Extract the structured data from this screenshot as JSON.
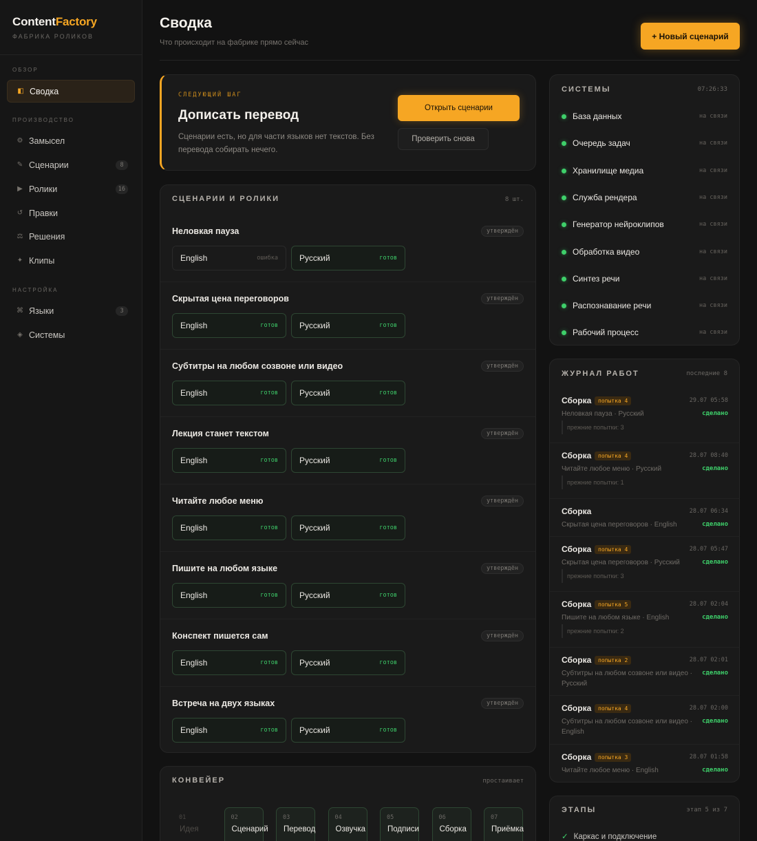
{
  "brand": {
    "name_part1": "Content",
    "name_part2": "Factory",
    "subtitle": "ФАБРИКА РОЛИКОВ"
  },
  "sidebar": {
    "sections": [
      {
        "label": "ОБЗОР"
      },
      {
        "label": "ПРОИЗВОДСТВО"
      },
      {
        "label": "НАСТРОЙКА"
      }
    ],
    "items": [
      {
        "label": "Сводка",
        "icon": "dashboard-icon",
        "glyph": "◧",
        "active": true
      },
      {
        "label": "Замысел",
        "icon": "idea-icon",
        "glyph": "⚙"
      },
      {
        "label": "Сценарии",
        "icon": "pen-icon",
        "glyph": "✎",
        "badge": "8"
      },
      {
        "label": "Ролики",
        "icon": "play-icon",
        "glyph": "▶",
        "badge": "16"
      },
      {
        "label": "Правки",
        "icon": "revisions-icon",
        "glyph": "↺"
      },
      {
        "label": "Решения",
        "icon": "decisions-icon",
        "glyph": "⚖"
      },
      {
        "label": "Клипы",
        "icon": "sparkle-icon",
        "glyph": "✦"
      },
      {
        "label": "Языки",
        "icon": "languages-icon",
        "glyph": "⌘",
        "badge": "3"
      },
      {
        "label": "Системы",
        "icon": "systems-icon",
        "glyph": "◈"
      }
    ]
  },
  "header": {
    "title": "Сводка",
    "subtitle": "Что происходит на фабрике прямо сейчас",
    "new_button": "+ Новый сценарий"
  },
  "next_step": {
    "label": "СЛЕДУЮЩИЙ ШАГ",
    "title": "Дописать перевод",
    "description": "Сценарии есть, но для части языков нет текстов. Без перевода собирать нечего.",
    "primary_button": "Открыть сценарии",
    "secondary_button": "Проверить снова"
  },
  "scripts": {
    "title": "СЦЕНАРИИ И РОЛИКИ",
    "count": "8 шт.",
    "items": [
      {
        "name": "Неловкая пауза",
        "status": "утверждён",
        "langs": [
          {
            "name": "English",
            "status": "ошибка",
            "error": true
          },
          {
            "name": "Русский",
            "status": "готов"
          }
        ]
      },
      {
        "name": "Скрытая цена переговоров",
        "status": "утверждён",
        "langs": [
          {
            "name": "English",
            "status": "готов"
          },
          {
            "name": "Русский",
            "status": "готов"
          }
        ]
      },
      {
        "name": "Субтитры на любом созвоне или видео",
        "status": "утверждён",
        "langs": [
          {
            "name": "English",
            "status": "готов"
          },
          {
            "name": "Русский",
            "status": "готов"
          }
        ]
      },
      {
        "name": "Лекция станет текстом",
        "status": "утверждён",
        "langs": [
          {
            "name": "English",
            "status": "готов"
          },
          {
            "name": "Русский",
            "status": "готов"
          }
        ]
      },
      {
        "name": "Читайте любое меню",
        "status": "утверждён",
        "langs": [
          {
            "name": "English",
            "status": "готов"
          },
          {
            "name": "Русский",
            "status": "готов"
          }
        ]
      },
      {
        "name": "Пишите на любом языке",
        "status": "утверждён",
        "langs": [
          {
            "name": "English",
            "status": "готов"
          },
          {
            "name": "Русский",
            "status": "готов"
          }
        ]
      },
      {
        "name": "Конспект пишется сам",
        "status": "утверждён",
        "langs": [
          {
            "name": "English",
            "status": "готов"
          },
          {
            "name": "Русский",
            "status": "готов"
          }
        ]
      },
      {
        "name": "Встреча на двух языках",
        "status": "утверждён",
        "langs": [
          {
            "name": "English",
            "status": "готов"
          },
          {
            "name": "Русский",
            "status": "готов"
          }
        ]
      }
    ]
  },
  "pipeline": {
    "title": "КОНВЕЙЕР",
    "status": "простаивает",
    "steps": [
      {
        "num": "01",
        "name": "Идея",
        "idle": true
      },
      {
        "num": "02",
        "name": "Сценарий"
      },
      {
        "num": "03",
        "name": "Перевод"
      },
      {
        "num": "04",
        "name": "Озвучка"
      },
      {
        "num": "05",
        "name": "Подписи"
      },
      {
        "num": "06",
        "name": "Сборка"
      },
      {
        "num": "07",
        "name": "Приёмка"
      }
    ]
  },
  "systems": {
    "title": "СИСТЕМЫ",
    "time": "07:26:33",
    "items": [
      {
        "name": "База данных",
        "status": "на связи"
      },
      {
        "name": "Очередь задач",
        "status": "на связи"
      },
      {
        "name": "Хранилище медиа",
        "status": "на связи"
      },
      {
        "name": "Служба рендера",
        "status": "на связи"
      },
      {
        "name": "Генератор нейроклипов",
        "status": "на связи"
      },
      {
        "name": "Обработка видео",
        "status": "на связи"
      },
      {
        "name": "Синтез речи",
        "status": "на связи"
      },
      {
        "name": "Распознавание речи",
        "status": "на связи"
      },
      {
        "name": "Рабочий процесс",
        "status": "на связи"
      }
    ],
    "status_color": "#3ecf6a"
  },
  "journal": {
    "title": "ЖУРНАЛ РАБОТ",
    "meta": "последние 8",
    "items": [
      {
        "name": "Сборка",
        "attempt": "попытка 4",
        "time": "29.07 05:58",
        "desc": "Неловкая пауза · Русский",
        "result": "сделано",
        "prev": "прежние попытки: 3"
      },
      {
        "name": "Сборка",
        "attempt": "попытка 4",
        "time": "28.07 08:40",
        "desc": "Читайте любое меню · Русский",
        "result": "сделано",
        "prev": "прежние попытки: 1"
      },
      {
        "name": "Сборка",
        "attempt": "",
        "time": "28.07 06:34",
        "desc": "Скрытая цена переговоров · English",
        "result": "сделано",
        "prev": ""
      },
      {
        "name": "Сборка",
        "attempt": "попытка 4",
        "time": "28.07 05:47",
        "desc": "Скрытая цена переговоров · Русский",
        "result": "сделано",
        "prev": "прежние попытки: 3"
      },
      {
        "name": "Сборка",
        "attempt": "попытка 5",
        "time": "28.07 02:04",
        "desc": "Пишите на любом языке · English",
        "result": "сделано",
        "prev": "прежние попытки: 2"
      },
      {
        "name": "Сборка",
        "attempt": "попытка 2",
        "time": "28.07 02:01",
        "desc": "Субтитры на любом созвоне или видео · Русский",
        "result": "сделано",
        "prev": ""
      },
      {
        "name": "Сборка",
        "attempt": "попытка 4",
        "time": "28.07 02:00",
        "desc": "Субтитры на любом созвоне или видео · English",
        "result": "сделано",
        "prev": ""
      },
      {
        "name": "Сборка",
        "attempt": "попытка 3",
        "time": "28.07 01:58",
        "desc": "Читайте любое меню · English",
        "result": "сделано",
        "prev": ""
      }
    ]
  },
  "stages": {
    "title": "ЭТАПЫ",
    "meta": "этап 5 из 7",
    "items": [
      {
        "label": "Каркас и подключение",
        "done": true
      }
    ]
  },
  "colors": {
    "accent": "#f6a623",
    "success": "#3ecf6a",
    "background": "#121212"
  }
}
